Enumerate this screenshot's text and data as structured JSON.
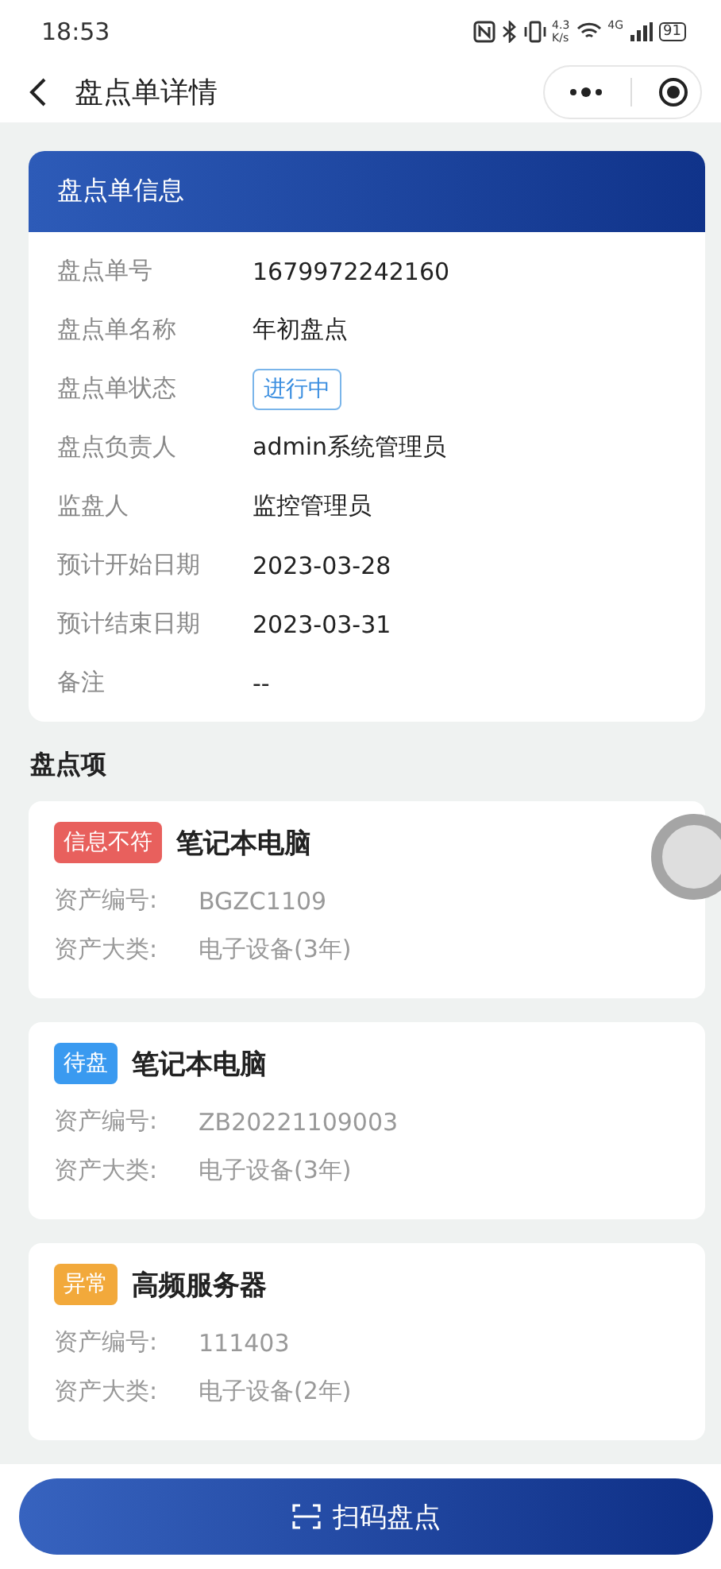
{
  "status_bar": {
    "time": "18:53",
    "speed_value": "4.3",
    "speed_unit": "K/s",
    "network": "4G",
    "battery": "91"
  },
  "nav": {
    "title": "盘点单详情"
  },
  "info_card": {
    "title": "盘点单信息",
    "fields": [
      {
        "kind": "text",
        "label": "盘点单号",
        "value": "1679972242160"
      },
      {
        "kind": "text",
        "label": "盘点单名称",
        "value": "年初盘点"
      },
      {
        "kind": "tag",
        "label": "盘点单状态",
        "value": "进行中"
      },
      {
        "kind": "text",
        "label": "盘点负责人",
        "value": "admin系统管理员"
      },
      {
        "kind": "text",
        "label": "监盘人",
        "value": "监控管理员"
      },
      {
        "kind": "text",
        "label": "预计开始日期",
        "value": "2023-03-28"
      },
      {
        "kind": "text",
        "label": "预计结束日期",
        "value": "2023-03-31"
      },
      {
        "kind": "text",
        "label": "备注",
        "value": "--"
      }
    ]
  },
  "items_section": {
    "title": "盘点项",
    "items": [
      {
        "status": "信息不符",
        "color": "#e8605d",
        "name": "笔记本电脑",
        "code_label": "资产编号:",
        "code": "BGZC1109",
        "category_label": "资产大类:",
        "category": "电子设备(3年)"
      },
      {
        "status": "待盘",
        "color": "#3a9af0",
        "name": "笔记本电脑",
        "code_label": "资产编号:",
        "code": "ZB20221109003",
        "category_label": "资产大类:",
        "category": "电子设备(3年)"
      },
      {
        "status": "异常",
        "color": "#f2a93b",
        "name": "高频服务器",
        "code_label": "资产编号:",
        "code": "111403",
        "category_label": "资产大类:",
        "category": "电子设备(2年)"
      }
    ]
  },
  "scan_button": {
    "label": "扫码盘点"
  }
}
